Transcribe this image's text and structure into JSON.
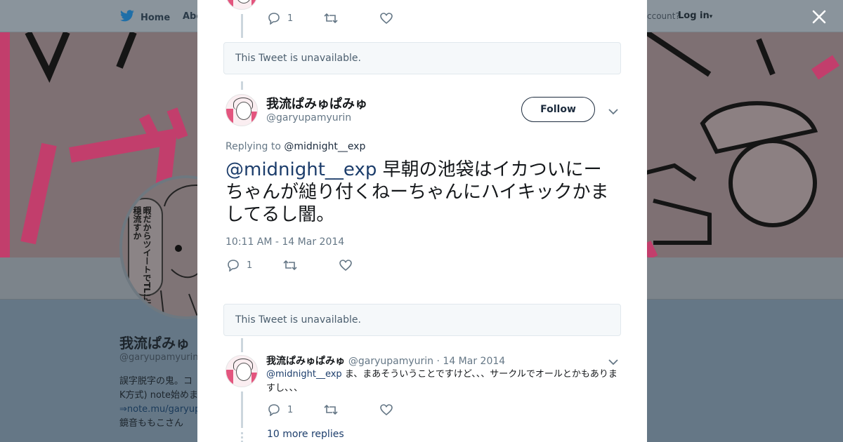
{
  "background": {
    "nav": {
      "home_label": "Home",
      "about_label": "Abo",
      "account_text": "ccount?",
      "login_label": "Log in"
    },
    "profile": {
      "name": "我流ぱみゅ",
      "handle": "@garyupamyurin",
      "bio_line1": "誤字脱字の鬼。コ",
      "bio_line2": "K方式) note始めま",
      "bio_link": "⇒note.mu/garyup",
      "bio_line4": "鏡音ももこさん"
    },
    "avatar_text": "暇だからツイートでTLに不穏流すか"
  },
  "modal": {
    "close_label": "×",
    "top_reply_count": "1",
    "unavailable_1": "This Tweet is unavailable.",
    "main_tweet": {
      "name": "我流ぱみゅぱみゅ",
      "handle": "@garyupamyurin",
      "follow_label": "Follow",
      "replying_to_prefix": "Replying to ",
      "replying_to_mention": "@midnight__exp",
      "mention": "@midnight__exp",
      "text": " 早朝の池袋はイカついにーちゃんが縋り付くねーちゃんにハイキックかましてるし闇。",
      "timestamp": "10:11 AM - 14 Mar 2014",
      "reply_count": "1"
    },
    "unavailable_2": "This Tweet is unavailable.",
    "reply_tweet": {
      "name": "我流ぱみゅぱみゅ",
      "handle": "@garyupamyurin",
      "separator": " · ",
      "date": "14 Mar 2014",
      "mention": "@midnight__exp",
      "text": " ま、まあそういうことですけど、、、サークルでオールとかもありますし、、、",
      "reply_count": "1"
    },
    "more_replies": "10 more replies"
  },
  "colors": {
    "overlay": "#657786",
    "banner_pink": "#d9457a",
    "link": "#1c3d6b",
    "muted": "#657786"
  }
}
